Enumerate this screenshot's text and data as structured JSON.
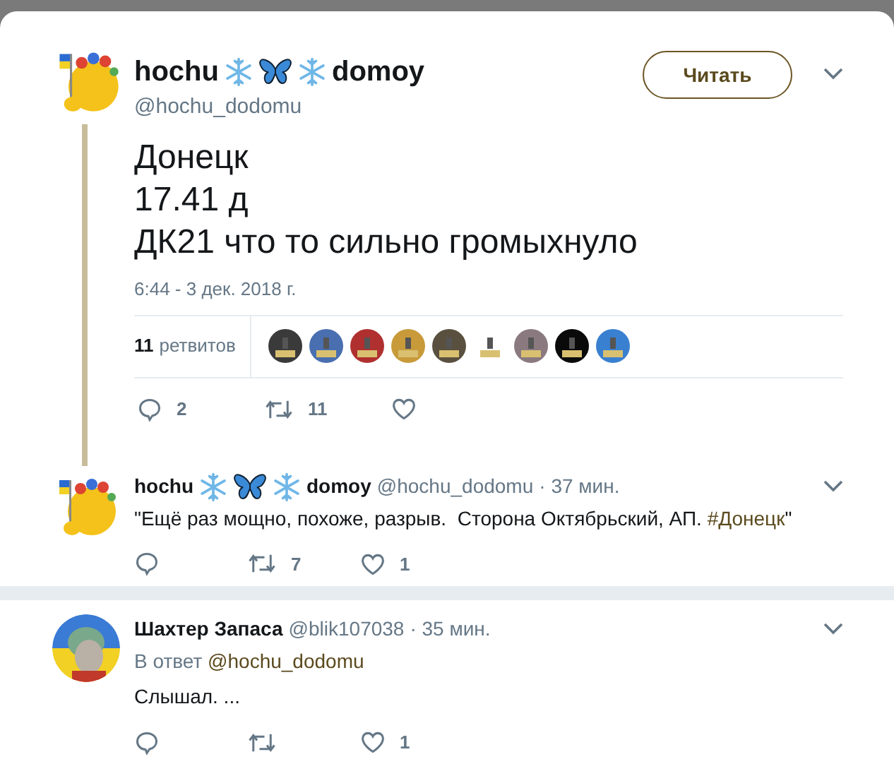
{
  "tweet": {
    "author": {
      "name_parts": [
        "hochu",
        "domoy"
      ],
      "handle": "@hochu_dodomu"
    },
    "follow_button": "Читать",
    "text_lines": [
      "Донецк",
      "17.41 д",
      "ДК21 что то сильно громыхнуло"
    ],
    "timestamp": "6:44 - 3 дек. 2018 г.",
    "retweets": {
      "count": "11",
      "label": "ретвитов"
    },
    "retweeter_avatars": [
      {
        "color": "#3a3a3a"
      },
      {
        "color": "#4a6fb0"
      },
      {
        "color": "#b03030"
      },
      {
        "color": "#c89a3a"
      },
      {
        "color": "#5a5040"
      },
      {
        "color": "#ffffff"
      },
      {
        "color": "#8a7a80"
      },
      {
        "color": "#0a0a0a"
      },
      {
        "color": "#3a80d0"
      }
    ],
    "actions": [
      {
        "kind": "reply",
        "count": "2"
      },
      {
        "kind": "retweet",
        "count": "11"
      },
      {
        "kind": "like"
      }
    ]
  },
  "replies": [
    {
      "author": {
        "name_parts": [
          "hochu",
          "domoy"
        ],
        "handle": "@hochu_dodomu"
      },
      "time": "· 37 мин.",
      "text": "\"Ещё раз мощно, похоже, разрыв.  Сторона Октябрьский, АП. ",
      "hashtag": "#Донецк",
      "text_end": "\"",
      "actions": [
        {
          "kind": "reply"
        },
        {
          "kind": "retweet",
          "count": "7"
        },
        {
          "kind": "like",
          "count": "1"
        }
      ]
    },
    {
      "author": {
        "name_parts": [
          "Шахтер Запаса"
        ],
        "handle": "@blik107038"
      },
      "time": "· 35 мин.",
      "reply_to_label": "В ответ",
      "reply_to": "@hochu_dodomu",
      "text": "Слышал. ...",
      "actions": [
        {
          "kind": "reply"
        },
        {
          "kind": "retweet"
        },
        {
          "kind": "like",
          "count": "1"
        }
      ]
    }
  ]
}
